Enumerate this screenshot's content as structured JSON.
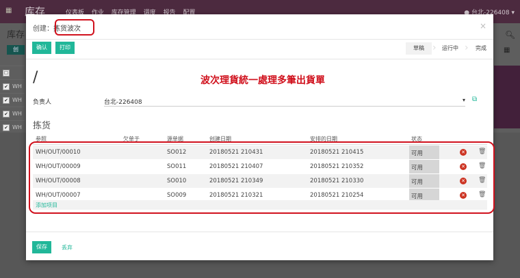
{
  "background": {
    "app_title": "库存",
    "nav": [
      "仪表板",
      "作业",
      "库存管理",
      "调度",
      "报告",
      "配置"
    ],
    "user": "台北-226408",
    "page_title": "库存",
    "create_label": "创",
    "list_rows": [
      "WH",
      "WH",
      "WH",
      "WH"
    ]
  },
  "modal": {
    "breadcrumb_prefix": "创建：",
    "breadcrumb_current": "拣货波次",
    "close": "×",
    "buttons": {
      "confirm": "确认",
      "print": "打印"
    },
    "stages": [
      {
        "label": "草稿",
        "active": true
      },
      {
        "label": "运行中",
        "active": false
      },
      {
        "label": "完成",
        "active": false
      }
    ],
    "record_name": "/",
    "annotation": "波次理貨統一處理多筆出貨單",
    "responsible": {
      "label": "负责人",
      "value": "台北-226408"
    },
    "section_title": "拣货",
    "columns": [
      "参照",
      "欠单于",
      "源单据",
      "创建日期",
      "安排的日期",
      "状态"
    ],
    "rows": [
      {
        "ref": "WH/OUT/00010",
        "backorder": "",
        "source": "SO012",
        "created": "20180521 210431",
        "scheduled": "20180521 210415",
        "status": "可用"
      },
      {
        "ref": "WH/OUT/00009",
        "backorder": "",
        "source": "SO011",
        "created": "20180521 210407",
        "scheduled": "20180521 210352",
        "status": "可用"
      },
      {
        "ref": "WH/OUT/00008",
        "backorder": "",
        "source": "SO010",
        "created": "20180521 210349",
        "scheduled": "20180521 210330",
        "status": "可用"
      },
      {
        "ref": "WH/OUT/00007",
        "backorder": "",
        "source": "SO009",
        "created": "20180521 210321",
        "scheduled": "20180521 210254",
        "status": "可用"
      }
    ],
    "add_item": "添加项目",
    "footer": {
      "save": "保存",
      "discard": "丢弃"
    }
  },
  "colors": {
    "accent": "#21b799",
    "annotation_red": "#d0101c",
    "topbar": "#4c2a3f"
  },
  "icons": [
    "apps-icon",
    "close-icon",
    "external-link-icon",
    "delete-icon",
    "trash-icon",
    "search-icon",
    "calendar-icon"
  ]
}
